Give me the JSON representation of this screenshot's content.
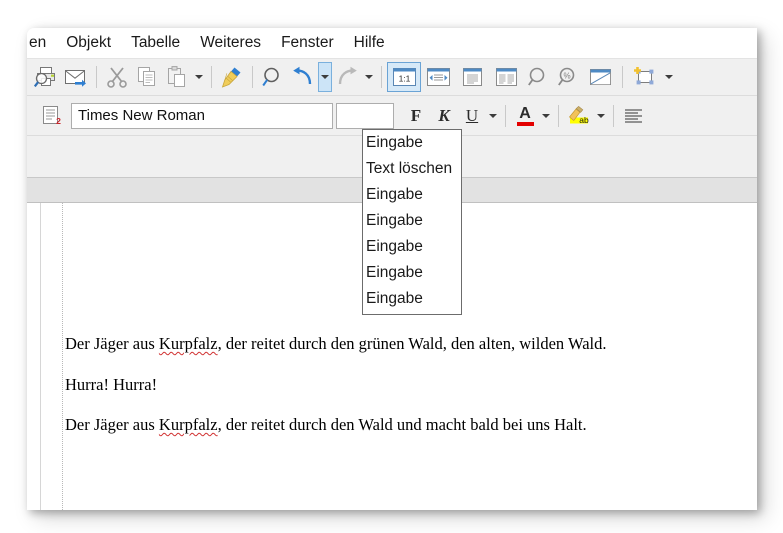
{
  "app": {
    "menubar": {
      "items": [
        {
          "label": "en",
          "name": "menu-item-einfuegen-clipped"
        },
        {
          "label": "Objekt",
          "name": "menu-item-objekt"
        },
        {
          "label": "Tabelle",
          "name": "menu-item-tabelle"
        },
        {
          "label": "Weiteres",
          "name": "menu-item-weiteres"
        },
        {
          "label": "Fenster",
          "name": "menu-item-fenster"
        },
        {
          "label": "Hilfe",
          "name": "menu-item-hilfe"
        }
      ]
    },
    "toolbar_standard": {
      "buttons": [
        {
          "name": "print-preview-icon",
          "tooltip": "Druckvorschau"
        },
        {
          "name": "email-icon",
          "tooltip": "Als E-Mail senden"
        },
        {
          "name": "cut-icon",
          "tooltip": "Ausschneiden"
        },
        {
          "name": "copy-icon",
          "tooltip": "Kopieren"
        },
        {
          "name": "paste-icon",
          "tooltip": "Einfuegen"
        },
        {
          "name": "clone-formatting-icon",
          "tooltip": "Formatierung uebertragen"
        },
        {
          "name": "find-icon",
          "tooltip": "Suchen und Ersetzen"
        },
        {
          "name": "undo-icon",
          "tooltip": "Rueckgaengig"
        },
        {
          "name": "redo-icon",
          "tooltip": "Wiederherstellen"
        },
        {
          "name": "zoom-100-icon",
          "tooltip": "1:1"
        },
        {
          "name": "zoom-page-width-icon",
          "tooltip": "Seitenbreite"
        },
        {
          "name": "zoom-one-page-icon",
          "tooltip": "Ganze Seite"
        },
        {
          "name": "zoom-two-pages-icon",
          "tooltip": "Zwei Seiten"
        },
        {
          "name": "zoom-in-icon",
          "tooltip": "Vergroessern"
        },
        {
          "name": "zoom-percent-icon",
          "tooltip": "Zoomfaktor"
        },
        {
          "name": "zoom-window-icon",
          "tooltip": "Fenster"
        },
        {
          "name": "insert-object-icon",
          "tooltip": "Objekt einfuegen"
        }
      ],
      "zoom_label": "1:1",
      "active_button": "zoom-100-icon",
      "undo_caret_active": true
    },
    "toolbar_format": {
      "paragraph_style_badge": "2",
      "font_name": "Times New Roman",
      "font_size": "",
      "bold_label": "F",
      "italic_label": "K",
      "underline_label": "U",
      "font_color_label": "A",
      "font_color_hex": "#e30000",
      "highlight_label": "ab",
      "highlight_hex": "#ffff00",
      "align_icon": "align-justify-icon"
    },
    "undo_menu": {
      "visible": true,
      "items": [
        {
          "label": "Eingabe"
        },
        {
          "label": "Text löschen"
        },
        {
          "label": "Eingabe"
        },
        {
          "label": "Eingabe"
        },
        {
          "label": "Eingabe"
        },
        {
          "label": "Eingabe"
        },
        {
          "label": "Eingabe"
        }
      ]
    },
    "document": {
      "paragraphs": [
        {
          "parts": [
            {
              "text": "Der Jäger aus ",
              "misspelled": false
            },
            {
              "text": "Kurpfalz",
              "misspelled": true
            },
            {
              "text": ", der reitet durch den grünen Wald, den alten, wilden Wald.",
              "misspelled": false
            }
          ]
        },
        {
          "parts": [
            {
              "text": "Hurra! Hurra!",
              "misspelled": false
            }
          ]
        },
        {
          "parts": [
            {
              "text": "Der Jäger aus ",
              "misspelled": false
            },
            {
              "text": "Kurpfalz",
              "misspelled": true
            },
            {
              "text": ", der reitet durch den Wald und macht bald bei uns Halt.",
              "misspelled": false
            }
          ]
        }
      ]
    }
  }
}
